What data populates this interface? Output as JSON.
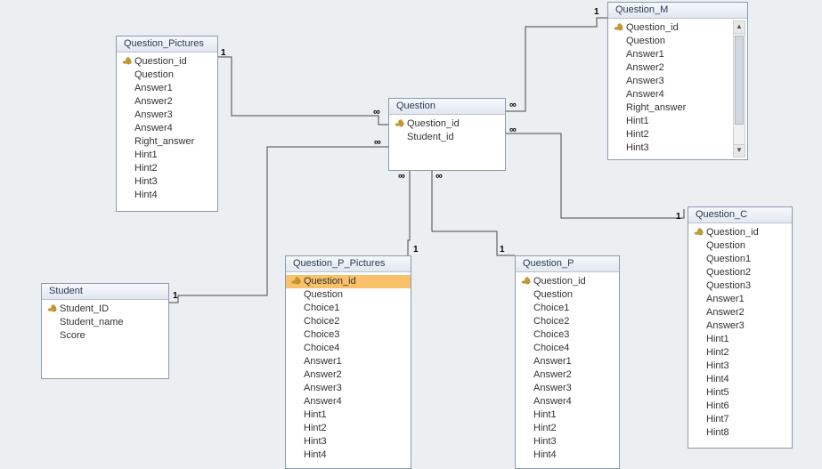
{
  "tables": {
    "question_pictures": {
      "title": "Question_Pictures",
      "fields": [
        {
          "name": "Question_id",
          "pk": true
        },
        {
          "name": "Question"
        },
        {
          "name": "Answer1"
        },
        {
          "name": "Answer2"
        },
        {
          "name": "Answer3"
        },
        {
          "name": "Answer4"
        },
        {
          "name": "Right_answer"
        },
        {
          "name": "Hint1"
        },
        {
          "name": "Hint2"
        },
        {
          "name": "Hint3"
        },
        {
          "name": "Hint4"
        }
      ]
    },
    "question": {
      "title": "Question",
      "fields": [
        {
          "name": "Question_id",
          "pk": true
        },
        {
          "name": "Student_id"
        }
      ]
    },
    "question_m": {
      "title": "Question_M",
      "fields": [
        {
          "name": "Question_id",
          "pk": true
        },
        {
          "name": "Question"
        },
        {
          "name": "Answer1"
        },
        {
          "name": "Answer2"
        },
        {
          "name": "Answer3"
        },
        {
          "name": "Answer4"
        },
        {
          "name": "Right_answer"
        },
        {
          "name": "Hint1"
        },
        {
          "name": "Hint2"
        },
        {
          "name": "Hint3"
        }
      ]
    },
    "student": {
      "title": "Student",
      "fields": [
        {
          "name": "Student_ID",
          "pk": true
        },
        {
          "name": "Student_name"
        },
        {
          "name": "Score"
        }
      ]
    },
    "question_p_pictures": {
      "title": "Question_P_Pictures",
      "fields": [
        {
          "name": "Question_id",
          "pk": true,
          "selected": true
        },
        {
          "name": "Question"
        },
        {
          "name": "Choice1"
        },
        {
          "name": "Choice2"
        },
        {
          "name": "Choice3"
        },
        {
          "name": "Choice4"
        },
        {
          "name": "Answer1"
        },
        {
          "name": "Answer2"
        },
        {
          "name": "Answer3"
        },
        {
          "name": "Answer4"
        },
        {
          "name": "Hint1"
        },
        {
          "name": "Hint2"
        },
        {
          "name": "Hint3"
        },
        {
          "name": "Hint4"
        }
      ]
    },
    "question_p": {
      "title": "Question_P",
      "fields": [
        {
          "name": "Question_id",
          "pk": true
        },
        {
          "name": "Question"
        },
        {
          "name": "Choice1"
        },
        {
          "name": "Choice2"
        },
        {
          "name": "Choice3"
        },
        {
          "name": "Choice4"
        },
        {
          "name": "Answer1"
        },
        {
          "name": "Answer2"
        },
        {
          "name": "Answer3"
        },
        {
          "name": "Answer4"
        },
        {
          "name": "Hint1"
        },
        {
          "name": "Hint2"
        },
        {
          "name": "Hint3"
        },
        {
          "name": "Hint4"
        }
      ]
    },
    "question_c": {
      "title": "Question_C",
      "fields": [
        {
          "name": "Question_id",
          "pk": true
        },
        {
          "name": "Question"
        },
        {
          "name": "Question1"
        },
        {
          "name": "Question2"
        },
        {
          "name": "Question3"
        },
        {
          "name": "Answer1"
        },
        {
          "name": "Answer2"
        },
        {
          "name": "Answer3"
        },
        {
          "name": "Hint1"
        },
        {
          "name": "Hint2"
        },
        {
          "name": "Hint3"
        },
        {
          "name": "Hint4"
        },
        {
          "name": "Hint5"
        },
        {
          "name": "Hint6"
        },
        {
          "name": "Hint7"
        },
        {
          "name": "Hint8"
        }
      ]
    }
  },
  "labels": {
    "one": "1",
    "many": "∞"
  }
}
